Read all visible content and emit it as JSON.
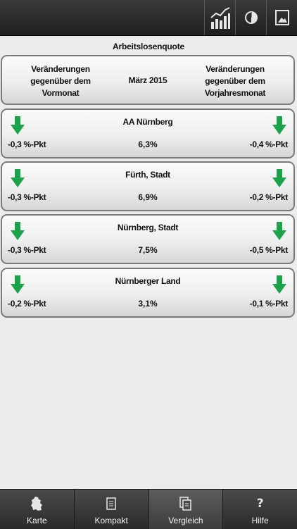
{
  "toolbar": {
    "icons": [
      "chart-icon",
      "pie-icon",
      "image-icon"
    ]
  },
  "title": "Arbeitslosenquote",
  "header": {
    "left_lines": [
      "Veränderungen",
      "gegenüber dem",
      "Vormonat"
    ],
    "middle": "März 2015",
    "right_lines": [
      "Veränderungen",
      "gegenüber dem",
      "Vorjahresmonat"
    ]
  },
  "rows": [
    {
      "name": "AA Nürnberg",
      "value": "6,3%",
      "left": "-0,3 %-Pkt",
      "right": "-0,4 %-Pkt",
      "left_trend": "down",
      "right_trend": "down"
    },
    {
      "name": "Fürth, Stadt",
      "value": "6,9%",
      "left": "-0,3 %-Pkt",
      "right": "-0,2 %-Pkt",
      "left_trend": "down",
      "right_trend": "down"
    },
    {
      "name": "Nürnberg, Stadt",
      "value": "7,5%",
      "left": "-0,3 %-Pkt",
      "right": "-0,5 %-Pkt",
      "left_trend": "down",
      "right_trend": "down"
    },
    {
      "name": "Nürnberger Land",
      "value": "3,1%",
      "left": "-0,2 %-Pkt",
      "right": "-0,1 %-Pkt",
      "left_trend": "down",
      "right_trend": "down"
    }
  ],
  "colors": {
    "arrow": "#1aa34a",
    "topbar": "#2b2b2b"
  },
  "tabs": [
    {
      "label": "Karte",
      "icon": "map-icon",
      "active": false
    },
    {
      "label": "Kompakt",
      "icon": "document-icon",
      "active": false
    },
    {
      "label": "Vergleich",
      "icon": "documents-icon",
      "active": true
    },
    {
      "label": "Hilfe",
      "icon": "question-icon",
      "active": false
    }
  ]
}
